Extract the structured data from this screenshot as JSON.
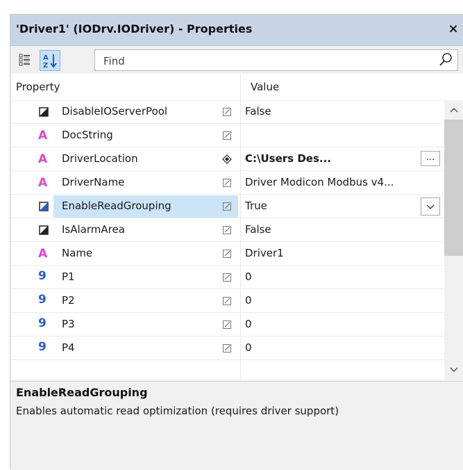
{
  "window": {
    "title": "'Driver1' (IODrv.IODriver) - Properties",
    "close_label": "×"
  },
  "toolbar": {
    "categorized_icon": "categorized-view-icon",
    "alphabetical_icon": "alphabetical-sort-icon",
    "find_placeholder": "Find",
    "find_icon": "search-icon"
  },
  "grid": {
    "header_property": "Property",
    "header_value": "Value",
    "selected_index": 4,
    "rows": [
      {
        "icon": "boolean-icon",
        "name": "DisableIOServerPool",
        "edit": "editable",
        "value": "False"
      },
      {
        "icon": "string-icon",
        "name": "DocString",
        "edit": "editable",
        "value": ""
      },
      {
        "icon": "string-icon",
        "name": "DriverLocation",
        "edit": "modified",
        "value": "C:\\Users        Des...",
        "bold": true,
        "button": "..."
      },
      {
        "icon": "string-icon",
        "name": "DriverName",
        "edit": "editable",
        "value": "Driver Modicon Modbus v4..."
      },
      {
        "icon": "boolean-icon",
        "name": "EnableReadGrouping",
        "edit": "editable",
        "value": "True",
        "dropdown": true
      },
      {
        "icon": "boolean-icon",
        "name": "IsAlarmArea",
        "edit": "editable",
        "value": "False"
      },
      {
        "icon": "string-icon",
        "name": "Name",
        "edit": "editable",
        "value": "Driver1"
      },
      {
        "icon": "number-icon",
        "name": "P1",
        "edit": "editable",
        "value": "0"
      },
      {
        "icon": "number-icon",
        "name": "P2",
        "edit": "editable",
        "value": "0"
      },
      {
        "icon": "number-icon",
        "name": "P3",
        "edit": "editable",
        "value": "0"
      },
      {
        "icon": "number-icon",
        "name": "P4",
        "edit": "editable",
        "value": "0"
      }
    ]
  },
  "description": {
    "title": "EnableReadGrouping",
    "text": "Enables automatic read optimization (requires driver support)"
  },
  "colors": {
    "title_bar": "#c7d4e6",
    "selection": "#cce4f7",
    "string_icon": "#e046c6",
    "number_icon": "#2b5fc7"
  }
}
